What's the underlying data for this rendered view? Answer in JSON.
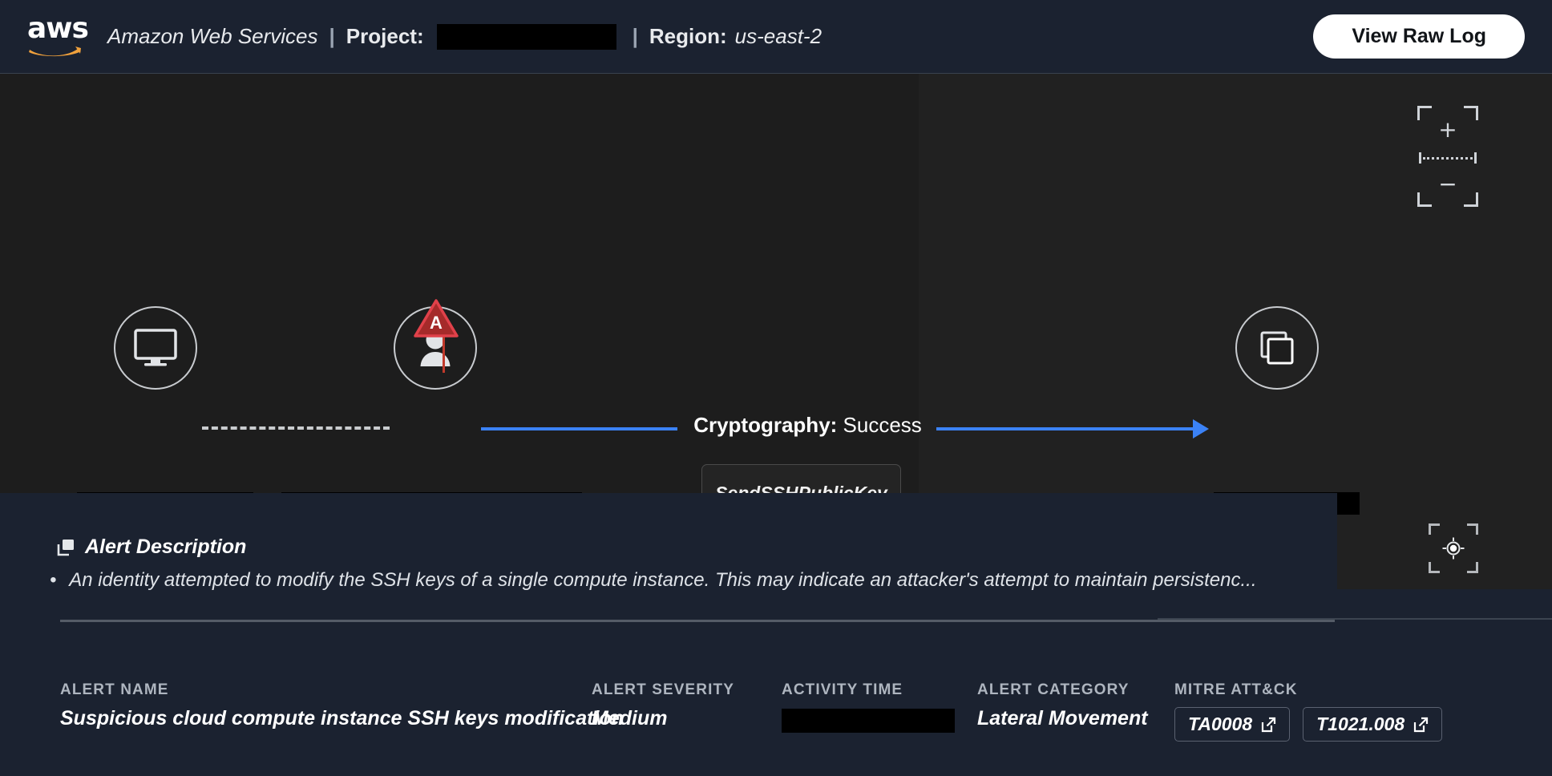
{
  "header": {
    "logo_wordmark": "aws",
    "logo_icon": "aws-smile-logo",
    "provider": "Amazon Web Services",
    "separator": "|",
    "project_label": "Project:",
    "project_value_redacted": true,
    "region_label": "Region:",
    "region_value": "us-east-2",
    "raw_log_button": "View Raw Log"
  },
  "graph": {
    "zoom_control": {
      "plus": "+",
      "minus": "−",
      "name": "zoom-slider"
    },
    "recenter_control": {
      "name": "recenter-target"
    },
    "nodes": [
      {
        "id": "source-host",
        "icon": "monitor-icon",
        "label_redacted": true
      },
      {
        "id": "identity",
        "icon": "user-icon",
        "label_redacted": true,
        "alert_badge": "A"
      },
      {
        "id": "compute-instance",
        "icon": "instance-icon",
        "label_redacted": true
      }
    ],
    "edges": [
      {
        "from": "source-host",
        "to": "identity",
        "style": "dashed"
      },
      {
        "from": "identity",
        "to": "compute-instance",
        "style": "solid-arrow",
        "label_prefix": "Cryptography:",
        "label_suffix": "Success",
        "color": "#3b82f6"
      }
    ],
    "action_chip": "SendSSHPublicKey"
  },
  "description": {
    "icon": "window-panel-icon",
    "heading": "Alert Description",
    "bullet": "•",
    "text": "An identity attempted to modify the SSH keys of a single compute instance. This may indicate an attacker's attempt to maintain persistenc..."
  },
  "meta": {
    "alert_name": {
      "label": "ALERT NAME",
      "value": "Suspicious cloud compute instance SSH keys modification"
    },
    "alert_severity": {
      "label": "ALERT SEVERITY",
      "value": "Medium"
    },
    "activity_time": {
      "label": "ACTIVITY TIME",
      "value_redacted": true
    },
    "alert_category": {
      "label": "ALERT CATEGORY",
      "value": "Lateral Movement"
    },
    "mitre": {
      "label": "MITRE ATT&CK",
      "chips": [
        {
          "code": "TA0008",
          "icon": "external-link-icon"
        },
        {
          "code": "T1021.008",
          "icon": "external-link-icon"
        }
      ]
    }
  },
  "colors": {
    "header_bg": "#1b2230",
    "canvas_bg": "#1d1d1d",
    "panel_bg": "#1b2230",
    "accent_blue": "#3b82f6",
    "alert_red": "#c0392b",
    "aws_orange": "#f0a13c"
  }
}
